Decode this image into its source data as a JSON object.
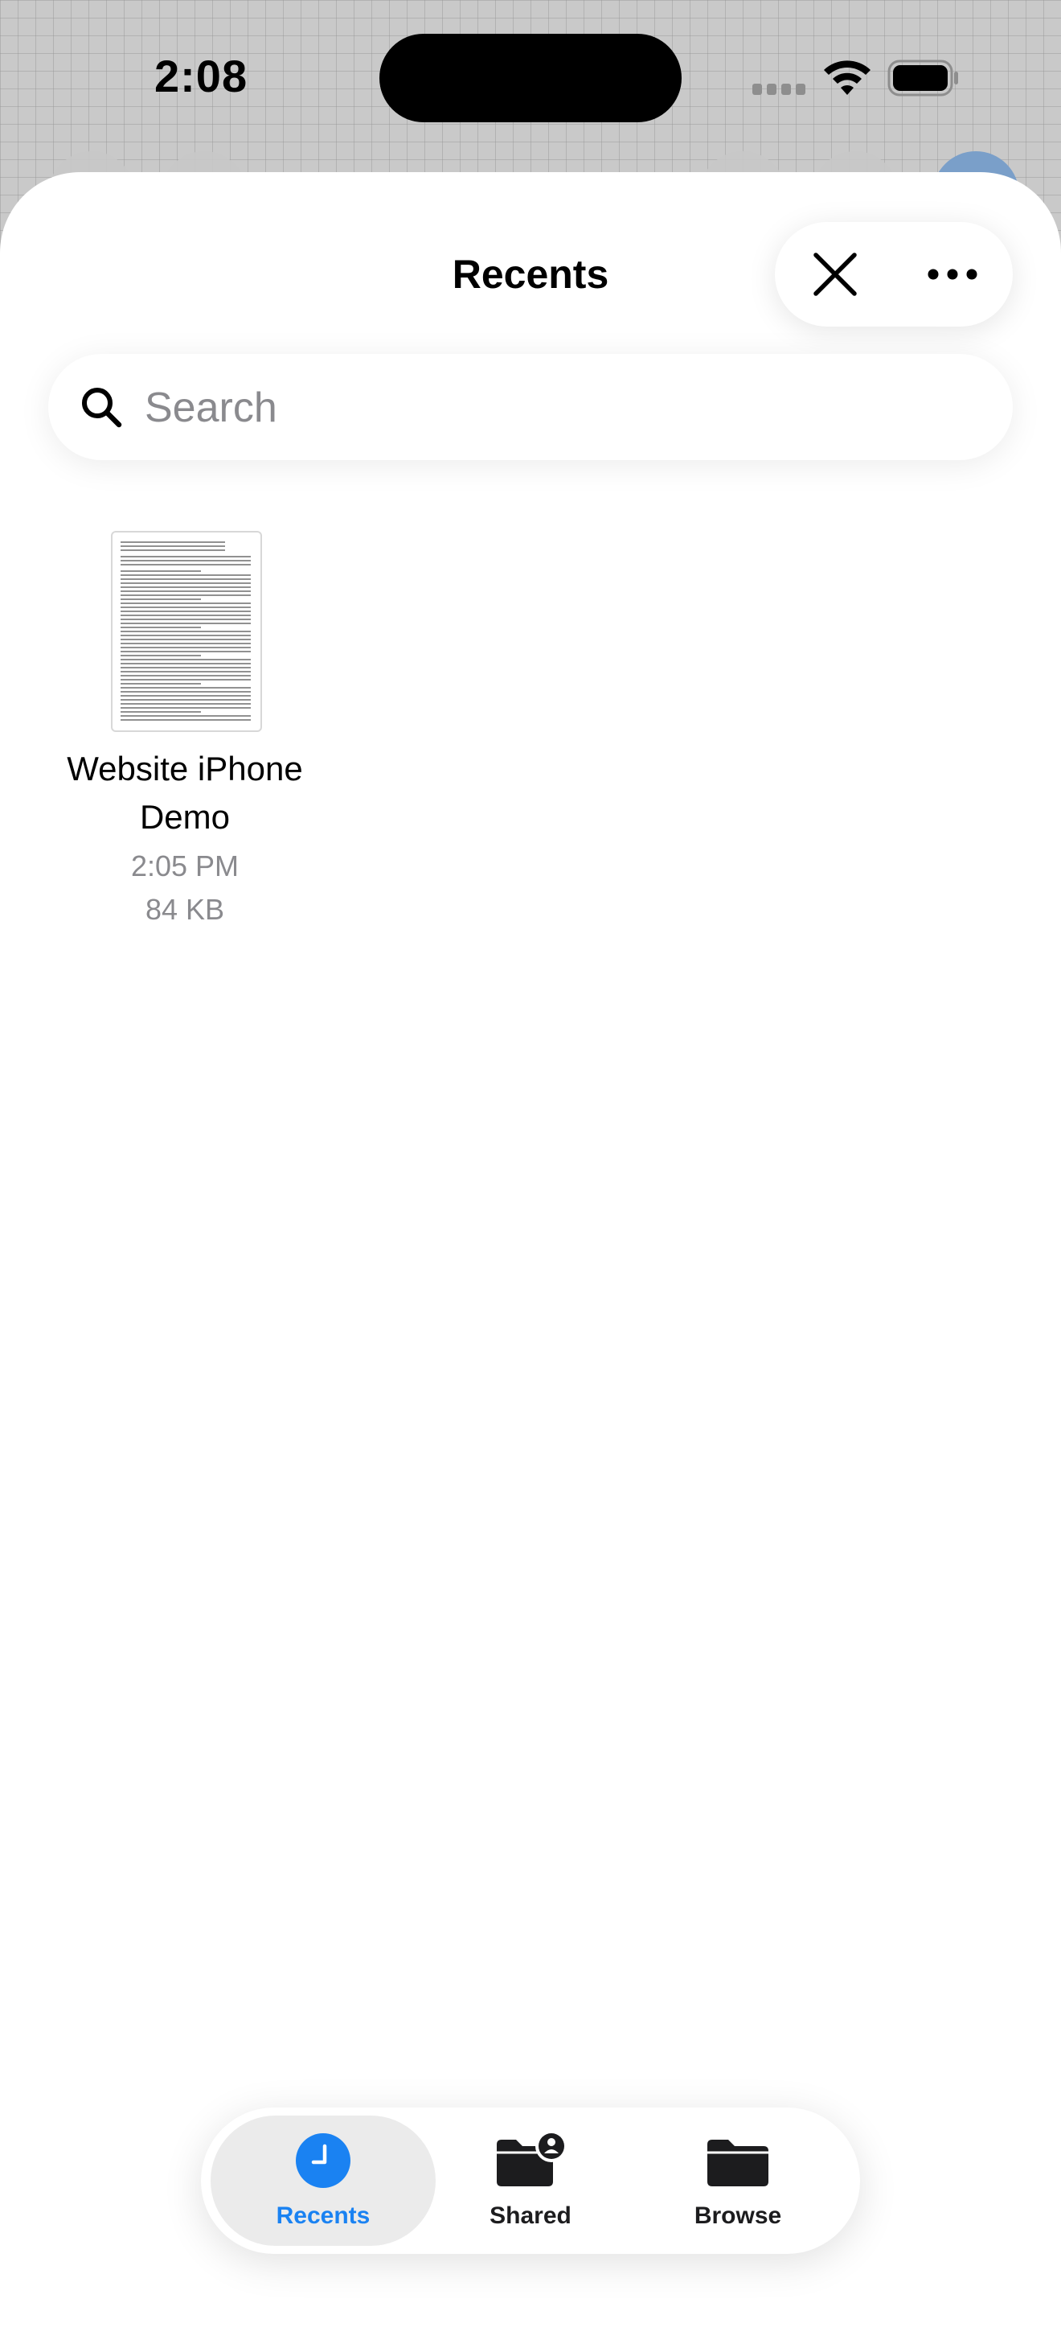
{
  "status_bar": {
    "time": "2:08"
  },
  "header": {
    "title": "Recents",
    "close_icon": "close-icon",
    "more_icon": "ellipsis-icon"
  },
  "search": {
    "placeholder": "Search",
    "value": "",
    "icon": "search-icon"
  },
  "files": [
    {
      "name": "Website iPhone Demo",
      "time": "2:05 PM",
      "size": "84 KB"
    }
  ],
  "tabbar": {
    "tabs": [
      {
        "label": "Recents",
        "icon": "clock-icon",
        "active": true
      },
      {
        "label": "Shared",
        "icon": "shared-folder-icon",
        "active": false
      },
      {
        "label": "Browse",
        "icon": "folder-icon",
        "active": false
      }
    ]
  },
  "colors": {
    "accent": "#1a82f2",
    "secondary_text": "#8a8a8e",
    "tab_active_bg": "#ebebeb"
  }
}
